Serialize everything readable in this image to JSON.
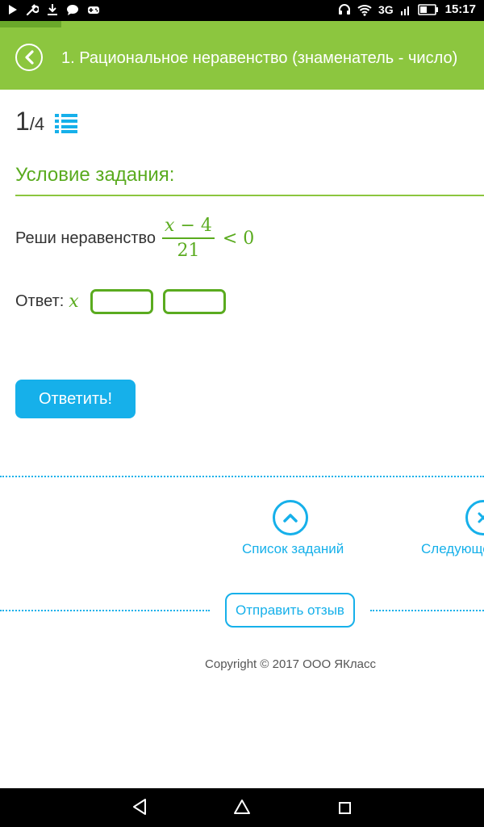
{
  "status_bar": {
    "network": "3G",
    "time": "15:17"
  },
  "header": {
    "title": "1. Рациональное неравенство (знаменатель - число)"
  },
  "counter": {
    "current": "1",
    "separator": "/",
    "total": "4"
  },
  "section": {
    "title": "Условие задания:"
  },
  "problem": {
    "prefix": "Реши неравенство",
    "numerator_var": "x",
    "numerator_rest": " − 4",
    "denominator": "21",
    "inequality": "< 0"
  },
  "answer": {
    "label": "Ответ:",
    "variable": "x",
    "field1_value": "",
    "field2_value": ""
  },
  "buttons": {
    "submit": "Ответить!",
    "feedback": "Отправить отзыв"
  },
  "navigation": {
    "task_list": "Список заданий",
    "next": "Следующее"
  },
  "footer": {
    "copyright": "Copyright © 2017 ООО ЯКласс"
  },
  "colors": {
    "green": "#8cc63f",
    "green_dark": "#5aab1f",
    "blue": "#16b0ea"
  }
}
